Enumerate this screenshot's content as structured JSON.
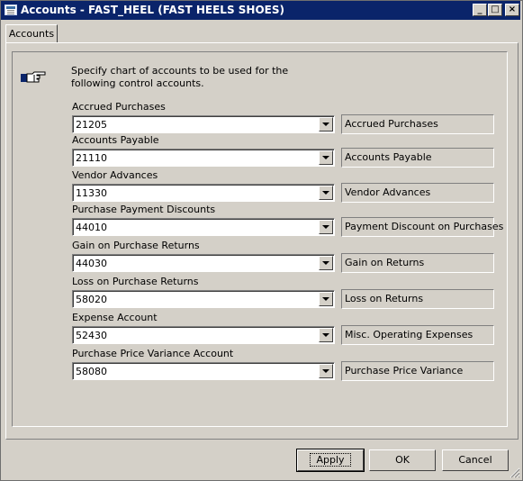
{
  "window": {
    "title": "Accounts - FAST_HEEL (FAST HEELS SHOES)"
  },
  "tabs": [
    {
      "label": "Accounts"
    }
  ],
  "info": {
    "text": "Specify chart of accounts to be used for the following control accounts.",
    "icon": "pointing-hand-icon"
  },
  "fields": [
    {
      "label": "Accrued Purchases",
      "value": "21205",
      "description": "Accrued Purchases"
    },
    {
      "label": "Accounts Payable",
      "value": "21110",
      "description": "Accounts Payable"
    },
    {
      "label": "Vendor Advances",
      "value": "11330",
      "description": "Vendor Advances"
    },
    {
      "label": "Purchase Payment Discounts",
      "value": "44010",
      "description": "Payment Discount on Purchases"
    },
    {
      "label": "Gain on Purchase Returns",
      "value": "44030",
      "description": "Gain on Returns"
    },
    {
      "label": "Loss on Purchase Returns",
      "value": "58020",
      "description": "Loss on Returns"
    },
    {
      "label": "Expense Account",
      "value": "52430",
      "description": "Misc. Operating Expenses"
    },
    {
      "label": "Purchase Price Variance Account",
      "value": "58080",
      "description": "Purchase Price Variance"
    }
  ],
  "buttons": {
    "apply": "Apply",
    "ok": "OK",
    "cancel": "Cancel"
  },
  "colors": {
    "titlebar": "#0a246a",
    "face": "#d4d0c8"
  }
}
